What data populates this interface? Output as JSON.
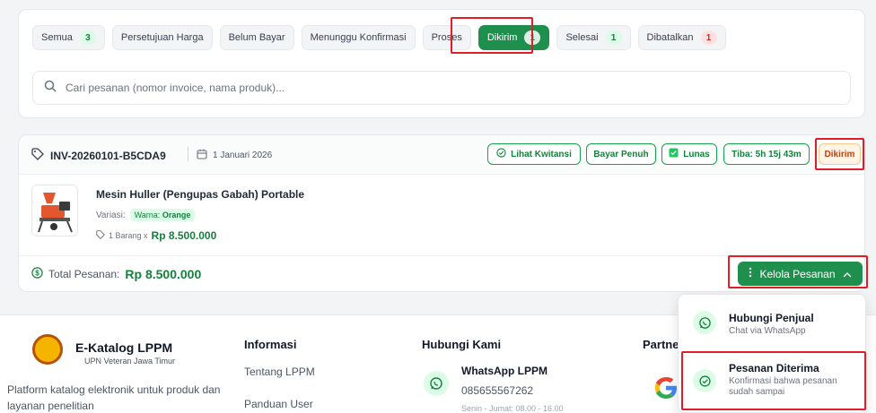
{
  "tabs": [
    {
      "label": "Semua",
      "count": "3",
      "count_color": "green"
    },
    {
      "label": "Persetujuan Harga"
    },
    {
      "label": "Belum Bayar"
    },
    {
      "label": "Menunggu Konfirmasi"
    },
    {
      "label": "Proses"
    },
    {
      "label": "Dikirim",
      "count": "1",
      "active": true
    },
    {
      "label": "Selesai",
      "count": "1",
      "count_color": "green"
    },
    {
      "label": "Dibatalkan",
      "count": "1",
      "count_color": "red"
    }
  ],
  "search": {
    "placeholder": "Cari pesanan (nomor invoice, nama produk)..."
  },
  "order": {
    "invoice": "INV-20260101-B5CDA9",
    "date": "1 Januari 2026",
    "badges": {
      "receipt": "Lihat Kwitansi",
      "payment_type": "Bayar Penuh",
      "payment_status": "Lunas",
      "eta": "Tiba: 5h 15j 43m",
      "status": "Dikirim"
    },
    "product": {
      "name": "Mesin Huller (Pengupas Gabah) Portable",
      "variant_label": "Variasi:",
      "variant_key": "Warna:",
      "variant_value": "Orange",
      "qty_text": "1 Barang x",
      "price": "Rp 8.500.000"
    },
    "total_label": "Total Pesanan:",
    "total_value": "Rp 8.500.000",
    "manage_label": "Kelola Pesanan"
  },
  "menu": [
    {
      "title": "Hubungi Penjual",
      "subtitle": "Chat via WhatsApp"
    },
    {
      "title": "Pesanan Diterima",
      "subtitle": "Konfirmasi bahwa pesanan sudah sampai"
    }
  ],
  "footer": {
    "brand": "E-Katalog LPPM",
    "brand_sub": "UPN Veteran Jawa Timur",
    "about": "Platform katalog elektronik untuk produk dan layanan penelitian",
    "info_title": "Informasi",
    "info_links": [
      "Tentang LPPM",
      "Panduan User"
    ],
    "contact_title": "Hubungi Kami",
    "wa_title": "WhatsApp LPPM",
    "wa_phone": "085655567262",
    "wa_hours": "Senin - Jumat: 08.00 - 16.00",
    "partner_title": "Partne"
  },
  "colors": {
    "accent": "#1f8f4d",
    "highlight": "#e11d2a",
    "status": "#c2410c"
  }
}
